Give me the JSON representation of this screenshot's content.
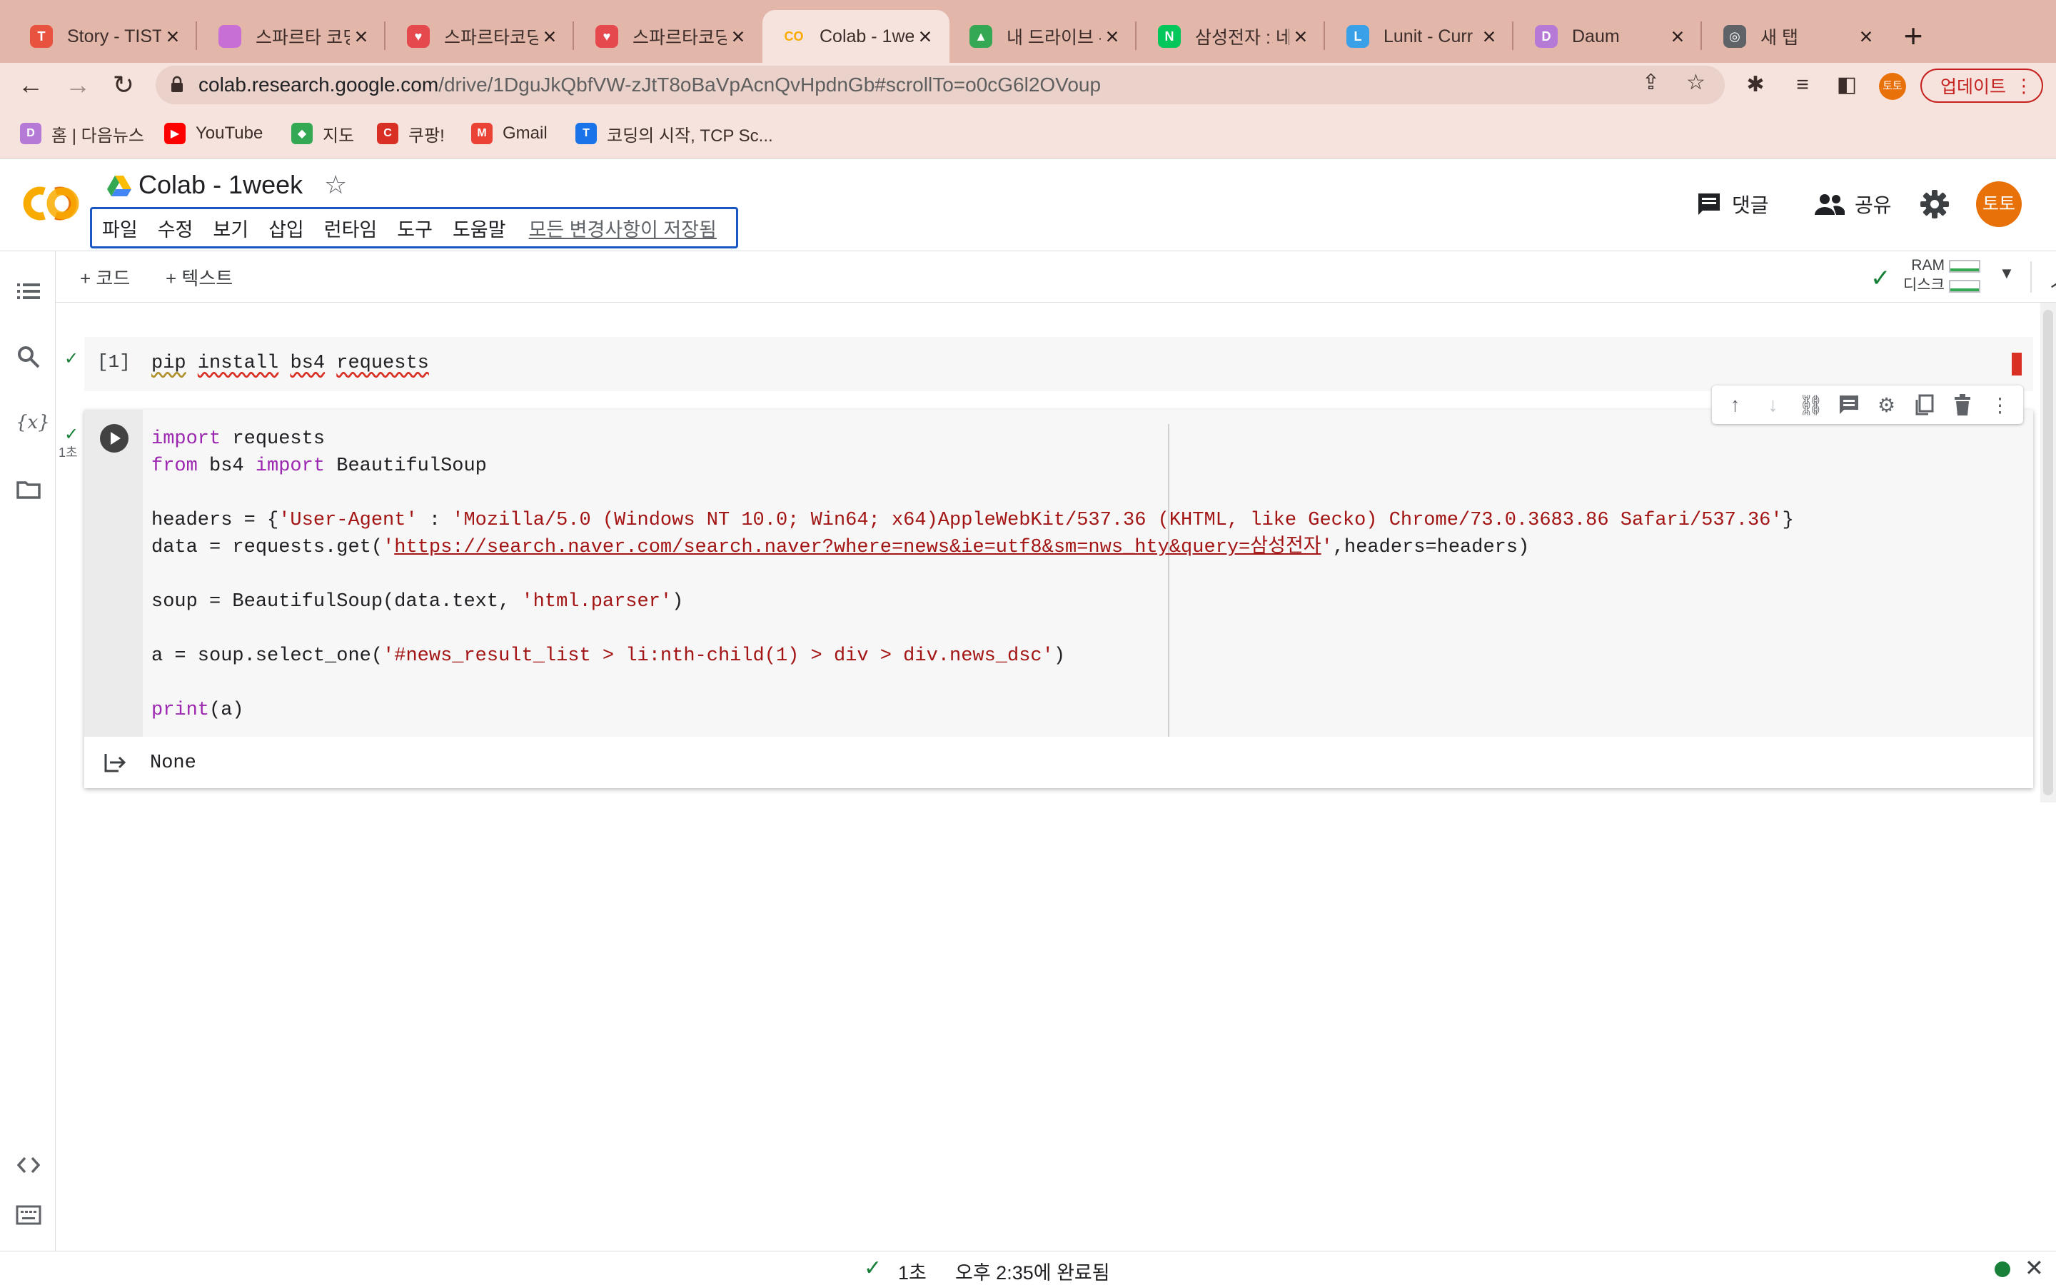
{
  "browser": {
    "tabs": [
      {
        "title": "Story - TIST",
        "favicon": "tistory-icon",
        "color": "#e8533f",
        "glyph": "T"
      },
      {
        "title": "스파르타 코딩",
        "favicon": "sparta-gradient-icon",
        "color": "#c86fd6",
        "glyph": ""
      },
      {
        "title": "스파르타코딩",
        "favicon": "sparta-heart-icon",
        "color": "#e5484d",
        "glyph": "♥"
      },
      {
        "title": "스파르타코딩",
        "favicon": "sparta-heart-icon",
        "color": "#e5484d",
        "glyph": "♥"
      },
      {
        "title": "Colab - 1we",
        "favicon": "colab-icon",
        "color": "#f9ab00",
        "glyph": "CO"
      },
      {
        "title": "내 드라이브 -",
        "favicon": "google-drive-icon",
        "color": "#34a853",
        "glyph": "▲"
      },
      {
        "title": "삼성전자 : 네",
        "favicon": "naver-icon",
        "color": "#03c75a",
        "glyph": "N"
      },
      {
        "title": "Lunit - Curr",
        "favicon": "lunit-icon",
        "color": "#3aa0e8",
        "glyph": "L"
      },
      {
        "title": "Daum",
        "favicon": "daum-icon",
        "color": "#b57ad6",
        "glyph": "D"
      },
      {
        "title": "새 탭",
        "favicon": "chrome-icon",
        "color": "#5f6368",
        "glyph": "◎"
      }
    ],
    "active_tab_index": 4,
    "url_host": "colab.research.google.com",
    "url_path": "/drive/1DguJkQbfVW-zJtT8oBaVpAcnQvHpdnGb#scrollTo=o0cG6l2OVoup",
    "profile_initials": "토토",
    "update_label": "업데이트",
    "bookmarks": [
      {
        "label": "홈 | 다음뉴스",
        "icon": "daum-icon",
        "color": "#b57ad6",
        "glyph": "D"
      },
      {
        "label": "YouTube",
        "icon": "youtube-icon",
        "color": "#ff0000",
        "glyph": "▶"
      },
      {
        "label": "지도",
        "icon": "google-maps-icon",
        "color": "#34a853",
        "glyph": "◆"
      },
      {
        "label": "쿠팡!",
        "icon": "coupang-icon",
        "color": "#d93025",
        "glyph": "C"
      },
      {
        "label": "Gmail",
        "icon": "gmail-icon",
        "color": "#ea4335",
        "glyph": "M"
      },
      {
        "label": "코딩의 시작, TCP Sc...",
        "icon": "tcp-school-icon",
        "color": "#1a73e8",
        "glyph": "T"
      }
    ]
  },
  "colab": {
    "title": "Colab - 1week",
    "menu": [
      "파일",
      "수정",
      "보기",
      "삽입",
      "런타임",
      "도구",
      "도움말"
    ],
    "save_status": "모든 변경사항이 저장됨",
    "comment_label": "댓글",
    "share_label": "공유",
    "user_initials": "토토",
    "add_code_label": "+ 코드",
    "add_text_label": "+ 텍스트",
    "ram_label": "RAM",
    "disk_label": "디스크"
  },
  "cells": {
    "cell1": {
      "exec_count": "[1]",
      "tokens": [
        "pip",
        "install",
        "bs4",
        "requests"
      ]
    },
    "cell2": {
      "exec_time": "1초",
      "lines": {
        "l1_kw": "import",
        "l1_rest": " requests",
        "l2_kw1": "from",
        "l2_mid": " bs4 ",
        "l2_kw2": "import",
        "l2_rest": " BeautifulSoup",
        "l4_pre": "headers = {",
        "l4_key": "'User-Agent'",
        "l4_mid": " : ",
        "l4_val": "'Mozilla/5.0 (Windows NT 10.0; Win64; x64)AppleWebKit/537.36 (KHTML, like Gecko) Chrome/73.0.3683.86 Safari/537.36'",
        "l4_post": "}",
        "l5_pre": "data = requests.get(",
        "l5_q1": "'",
        "l5_url": "https://search.naver.com/search.naver?where=news&ie=utf8&sm=nws_hty&query=삼성전자",
        "l5_q2": "'",
        "l5_post": ",headers=headers)",
        "l7_pre": "soup = BeautifulSoup(data.text, ",
        "l7_str": "'html.parser'",
        "l7_post": ")",
        "l9_pre": "a = soup.select_one(",
        "l9_str": "'#news_result_list > li:nth-child(1) > div > div.news_dsc'",
        "l9_post": ")",
        "l11_kw": "print",
        "l11_rest": "(a)"
      },
      "output": "None"
    }
  },
  "statusbar": {
    "duration": "1초",
    "completed": "오후 2:35에 완료됨"
  }
}
